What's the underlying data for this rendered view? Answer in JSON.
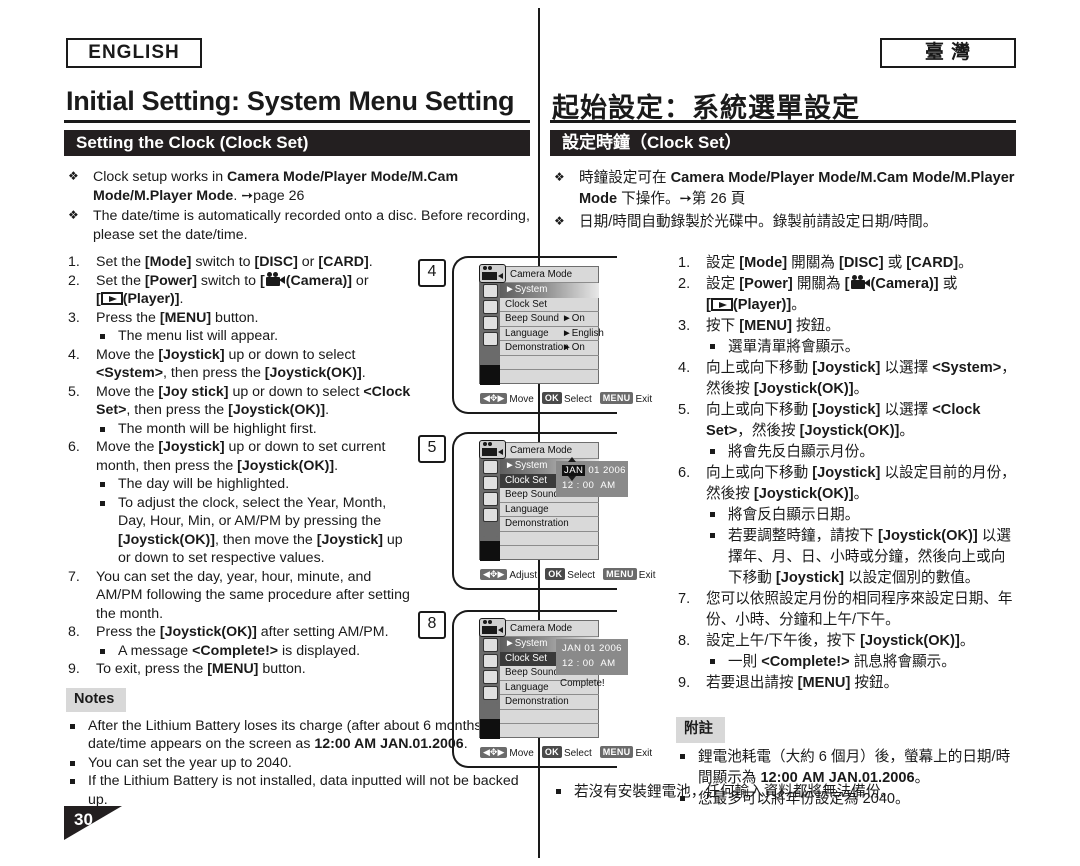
{
  "badges": {
    "english": "ENGLISH",
    "taiwan": "臺 灣"
  },
  "titles": {
    "en": "Initial Setting: System Menu Setting",
    "zh": "起始設定：系統選單設定"
  },
  "sections": {
    "en": "Setting the Clock (Clock Set)",
    "zh": "設定時鐘（Clock Set）"
  },
  "intro_en": {
    "b1_a": "Clock setup works in ",
    "b1_b": "Camera Mode/Player Mode/M.Cam Mode/M.Player Mode",
    "b1_c": ". ",
    "b1_d": "page 26",
    "b2": "The date/time is automatically recorded onto a disc. Before recording, please set the date/time."
  },
  "intro_zh": {
    "b1_a": "時鐘設定可在 ",
    "b1_b": "Camera Mode/Player Mode/M.Cam Mode/M.Player Mode",
    "b1_c": " 下操作。",
    "b1_d": "第 26 頁",
    "b2": "日期/時間自動錄製於光碟中。錄製前請設定日期/時間。"
  },
  "steps_en": [
    {
      "n": "1."
    },
    {
      "n": "2."
    },
    {
      "n": "3."
    },
    {
      "n": "4."
    },
    {
      "n": "5."
    },
    {
      "n": "6."
    },
    {
      "n": "7."
    },
    {
      "n": "8."
    },
    {
      "n": "9."
    }
  ],
  "en": {
    "s1_a": "Set the ",
    "s1_b": "[Mode]",
    "s1_c": " switch to ",
    "s1_d": "[DISC]",
    "s1_e": " or ",
    "s1_f": "[CARD]",
    "s1_g": ".",
    "s2_a": "Set the ",
    "s2_b": "[Power]",
    "s2_c": " switch to ",
    "s2_d": "[",
    "s2_e": "(Camera)]",
    "s2_f": " or",
    "s2_g": "[",
    "s2_h": "(Player)]",
    "s2_i": ".",
    "s3_a": "Press the ",
    "s3_b": "[MENU]",
    "s3_c": " button.",
    "s3_sub": "The menu list will appear.",
    "s4_a": "Move the ",
    "s4_b": "[Joystick]",
    "s4_c": " up or down to select ",
    "s4_d": "<System>",
    "s4_e": ", then press the ",
    "s4_f": "[Joystick(OK)]",
    "s4_g": ".",
    "s5_a": "Move the ",
    "s5_b": "[Joy stick]",
    "s5_c": " up or down to select ",
    "s5_d": "<Clock Set>",
    "s5_e": ", then press the ",
    "s5_f": "[Joystick(OK)]",
    "s5_g": ".",
    "s5_sub": "The month will be highlight first.",
    "s6_a": "Move the ",
    "s6_b": "[Joystick]",
    "s6_c": " up or down to set current month, then press the ",
    "s6_d": "[Joystick(OK)]",
    "s6_e": ".",
    "s6_sub1": "The day will be highlighted.",
    "s6_sub2_a": "To adjust the clock, select the Year, Month, Day, Hour, Min, or AM/PM by pressing the ",
    "s6_sub2_b": "[Joystick(OK)]",
    "s6_sub2_c": ", then move the ",
    "s6_sub2_d": "[Joystick]",
    "s6_sub2_e": " up or down to set respective values.",
    "s7": "You can set the day, year, hour, minute, and AM/PM following the same procedure after setting the month.",
    "s8_a": "Press the ",
    "s8_b": "[Joystick(OK)]",
    "s8_c": " after setting AM/PM.",
    "s8_sub_a": "A message ",
    "s8_sub_b": "<Complete!>",
    "s8_sub_c": " is displayed.",
    "s9_a": "To exit, press the ",
    "s9_b": "[MENU]",
    "s9_c": " button.",
    "notes_title": "Notes",
    "note1_a": "After the Lithium Battery loses its charge (after about 6 months), the date/time appears on the screen as ",
    "note1_b": "12:00 AM JAN.01.2006",
    "note1_c": ".",
    "note2": "You can set the year up to 2040.",
    "note3": "If the Lithium Battery is not installed, data inputted will not be backed up."
  },
  "zh": {
    "s1_a": "設定 ",
    "s1_b": "[Mode]",
    "s1_c": " 開關為 ",
    "s1_d": "[DISC]",
    "s1_e": " 或 ",
    "s1_f": "[CARD]",
    "s1_g": "。",
    "s2_a": "設定 ",
    "s2_b": "[Power]",
    "s2_c": " 開關為 ",
    "s2_d": "[",
    "s2_e": "(Camera)]",
    "s2_f": " 或",
    "s2_g": "[",
    "s2_h": "(Player)]",
    "s2_i": "。",
    "s3_a": "按下 ",
    "s3_b": "[MENU]",
    "s3_c": " 按鈕。",
    "s3_sub": "選單清單將會顯示。",
    "s4_a": "向上或向下移動 ",
    "s4_b": "[Joystick]",
    "s4_c": " 以選擇 ",
    "s4_d": "<System>",
    "s4_e": "，然後按 ",
    "s4_f": "[Joystick(OK)]",
    "s4_g": "。",
    "s5_a": "向上或向下移動 ",
    "s5_b": "[Joystick]",
    "s5_c": " 以選擇 ",
    "s5_d": "<Clock Set>",
    "s5_e": "，然後按 ",
    "s5_f": "[Joystick(OK)]",
    "s5_g": "。",
    "s5_sub": "將會先反白顯示月份。",
    "s6_a": "向上或向下移動 ",
    "s6_b": "[Joystick]",
    "s6_c": " 以設定目前的月份，然後按 ",
    "s6_d": "[Joystick(OK)]",
    "s6_e": "。",
    "s6_sub1": "將會反白顯示日期。",
    "s6_sub2_a": "若要調整時鐘，請按下 ",
    "s6_sub2_b": "[Joystick(OK)]",
    "s6_sub2_c": " 以選擇年、月、日、小時或分鐘，然後向上或向下移動 ",
    "s6_sub2_d": "[Joystick]",
    "s6_sub2_e": " 以設定個別的數值。",
    "s7": "您可以依照設定月份的相同程序來設定日期、年份、小時、分鐘和上午/下午。",
    "s8_a": "設定上午/下午後，按下 ",
    "s8_b": "[Joystick(OK)]",
    "s8_c": "。",
    "s8_sub_a": "一則 ",
    "s8_sub_b": "<Complete!>",
    "s8_sub_c": " 訊息將會顯示。",
    "s9_a": "若要退出請按 ",
    "s9_b": "[MENU]",
    "s9_c": " 按鈕。",
    "notes_title": "附註",
    "note1_a": "鋰電池耗電（大約 6 個月）後，螢幕上的日期/時間顯示為 ",
    "note1_b": "12:00 AM JAN.01.2006",
    "note1_c": "。",
    "note2": "您最多可以將年份設定為 2040。",
    "note3": "若沒有安裝鋰電池，任何輸入資料都將無法備份。"
  },
  "screens": [
    {
      "step_label": "4",
      "header": "Camera Mode",
      "rows": [
        {
          "label": "System",
          "value": ""
        },
        {
          "label": "Clock Set",
          "value": ""
        },
        {
          "label": "Beep Sound",
          "value": "On"
        },
        {
          "label": "Language",
          "value": "English"
        },
        {
          "label": "Demonstration",
          "value": "On"
        }
      ],
      "footer": {
        "move": "Move",
        "ok": "OK",
        "select": "Select",
        "menu": "MENU",
        "exit": "Exit"
      }
    },
    {
      "step_label": "5",
      "header": "Camera Mode",
      "rows": [
        {
          "label": "System",
          "value": ""
        },
        {
          "label": "Clock Set",
          "value": ""
        },
        {
          "label": "Beep Sound",
          "value": ""
        },
        {
          "label": "Language",
          "value": ""
        },
        {
          "label": "Demonstration",
          "value": ""
        }
      ],
      "clock": {
        "month": "JAN",
        "day": "01",
        "year": "2006",
        "hour": "12",
        "sep": ":",
        "minute": "00",
        "meridiem": "AM"
      },
      "footer": {
        "move": "Adjust",
        "ok": "OK",
        "select": "Select",
        "menu": "MENU",
        "exit": "Exit"
      }
    },
    {
      "step_label": "8",
      "header": "Camera Mode",
      "rows": [
        {
          "label": "System",
          "value": ""
        },
        {
          "label": "Clock Set",
          "value": ""
        },
        {
          "label": "Beep Sound",
          "value": ""
        },
        {
          "label": "Language",
          "value": ""
        },
        {
          "label": "Demonstration",
          "value": ""
        }
      ],
      "clock": {
        "month": "JAN",
        "day": "01",
        "year": "2006",
        "hour": "12",
        "sep": ":",
        "minute": "00",
        "meridiem": "AM"
      },
      "complete_message": "Complete!",
      "footer": {
        "move": "Move",
        "ok": "OK",
        "select": "Select",
        "menu": "MENU",
        "exit": "Exit"
      }
    }
  ],
  "page_number": "30"
}
